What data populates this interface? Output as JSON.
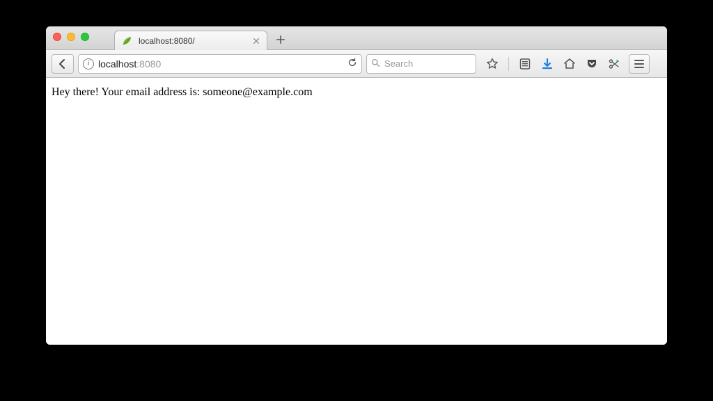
{
  "tab": {
    "title": "localhost:8080/",
    "favicon_color_a": "#8fc742",
    "favicon_color_b": "#4f8f1f"
  },
  "addressbar": {
    "host": "localhost",
    "port": ":8080"
  },
  "search": {
    "placeholder": "Search"
  },
  "page": {
    "body_text": "Hey there! Your email address is: someone@example.com"
  }
}
